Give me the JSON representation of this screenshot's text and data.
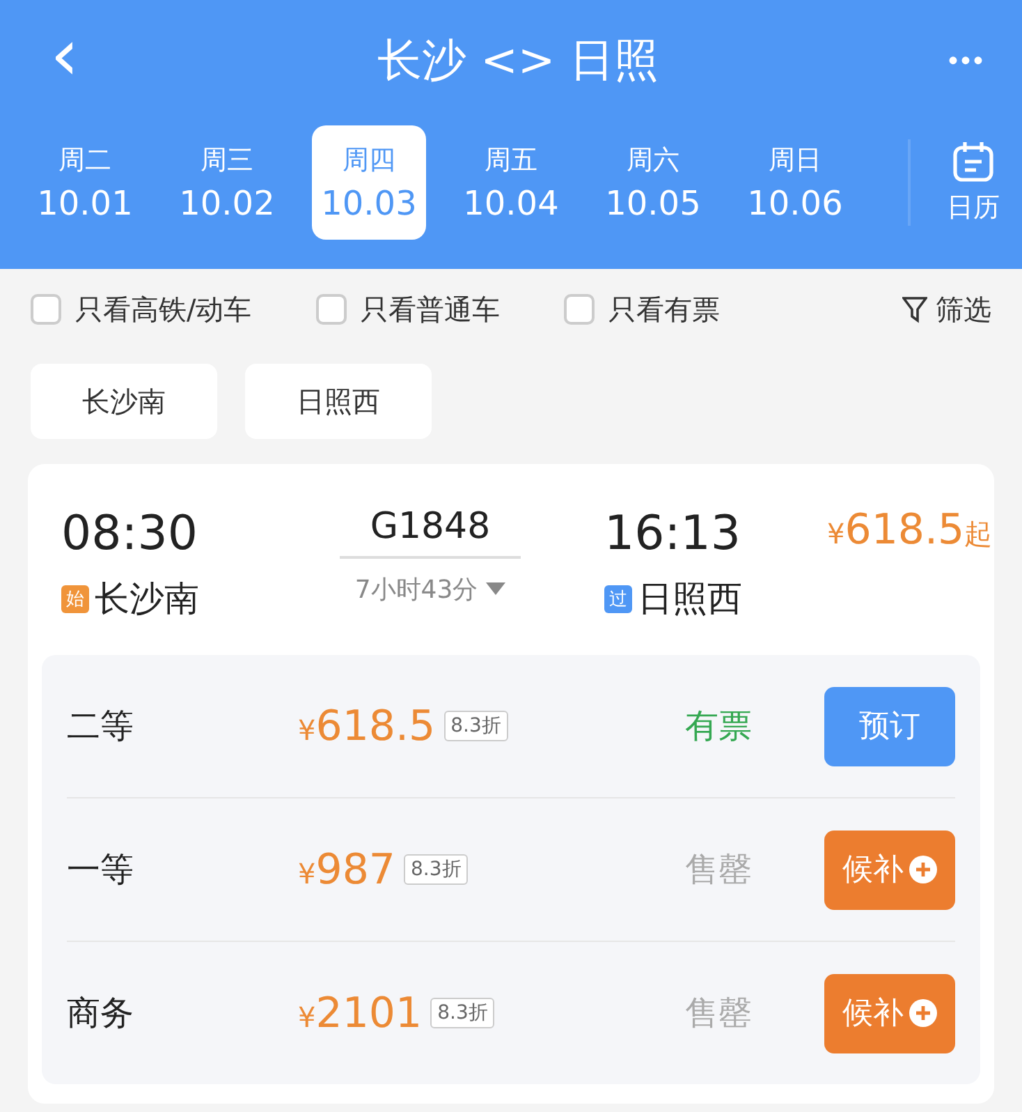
{
  "header": {
    "back": "‹",
    "title": "长沙 <> 日照",
    "more": "•••"
  },
  "dates": [
    {
      "weekday": "周二",
      "date": "10.01",
      "selected": false
    },
    {
      "weekday": "周三",
      "date": "10.02",
      "selected": false
    },
    {
      "weekday": "周四",
      "date": "10.03",
      "selected": true
    },
    {
      "weekday": "周五",
      "date": "10.04",
      "selected": false
    },
    {
      "weekday": "周六",
      "date": "10.05",
      "selected": false
    },
    {
      "weekday": "周日",
      "date": "10.06",
      "selected": false
    }
  ],
  "calendar": {
    "label": "日历"
  },
  "filters": [
    {
      "label": "只看高铁/动车",
      "checked": false
    },
    {
      "label": "只看普通车",
      "checked": false
    },
    {
      "label": "只看有票",
      "checked": false
    }
  ],
  "filter_button": {
    "label": "筛选"
  },
  "stations": [
    "长沙南",
    "日照西"
  ],
  "train": {
    "depart_time": "08:30",
    "number": "G1848",
    "duration": "7小时43分",
    "arrive_time": "16:13",
    "from": {
      "tag": "始",
      "color": "#f0943a",
      "name": "长沙南"
    },
    "to": {
      "tag": "过",
      "color": "#4f97f5",
      "name": "日照西"
    },
    "price": {
      "currency": "¥",
      "amount": "618.5",
      "suffix": "起"
    },
    "seats": [
      {
        "class": "二等",
        "currency": "¥",
        "amount": "618.5",
        "discount": "8.3折",
        "status": "有票",
        "available": true,
        "kind": "book",
        "action": "预订"
      },
      {
        "class": "一等",
        "currency": "¥",
        "amount": "987",
        "discount": "8.3折",
        "status": "售罄",
        "available": false,
        "kind": "waitlist",
        "action": "候补"
      },
      {
        "class": "商务",
        "currency": "¥",
        "amount": "2101",
        "discount": "8.3折",
        "status": "售罄",
        "available": false,
        "kind": "waitlist",
        "action": "候补"
      }
    ]
  }
}
